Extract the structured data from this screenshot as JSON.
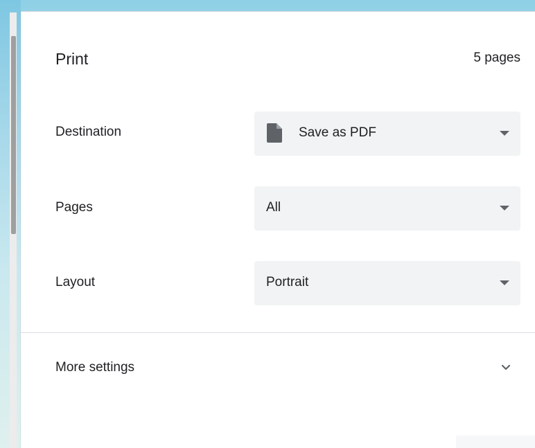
{
  "dialog": {
    "title": "Print",
    "page_count": "5 pages"
  },
  "settings": {
    "destination": {
      "label": "Destination",
      "value": "Save as PDF",
      "icon": "document-icon"
    },
    "pages": {
      "label": "Pages",
      "value": "All"
    },
    "layout": {
      "label": "Layout",
      "value": "Portrait"
    }
  },
  "more_settings": {
    "label": "More settings",
    "icon": "chevron-down-icon"
  },
  "colors": {
    "select_bg": "#f1f3f4",
    "text": "#202124",
    "icon": "#5f6368",
    "divider": "#dadce0"
  }
}
